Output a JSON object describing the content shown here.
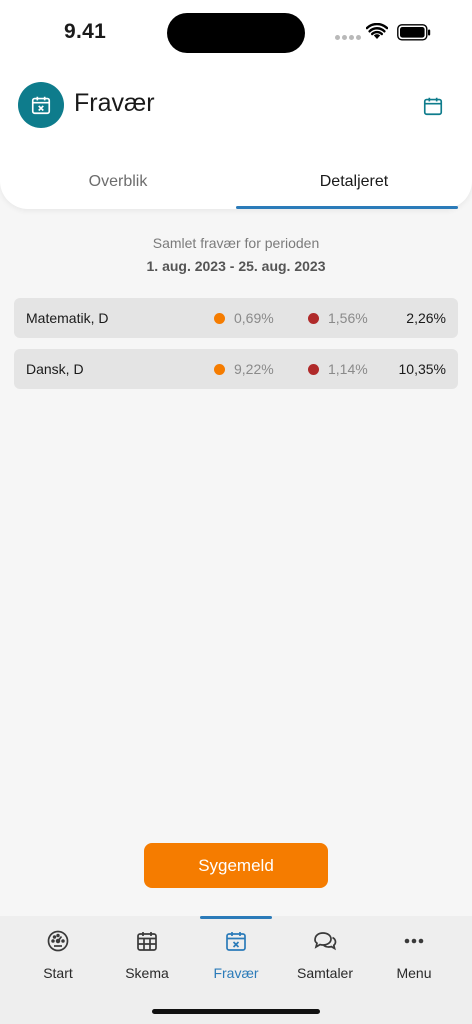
{
  "status_bar": {
    "time": "9.41"
  },
  "header": {
    "title": "Fravær"
  },
  "tabs": [
    {
      "label": "Overblik",
      "active": false
    },
    {
      "label": "Detaljeret",
      "active": true
    }
  ],
  "summary": {
    "label": "Samlet fravær for perioden",
    "period": "1. aug. 2023 - 25. aug. 2023"
  },
  "subjects": [
    {
      "name": "Matematik, D",
      "orange_value": "0,69%",
      "red_value": "1,56%",
      "total": "2,26%"
    },
    {
      "name": "Dansk, D",
      "orange_value": "9,22%",
      "red_value": "1,14%",
      "total": "10,35%"
    }
  ],
  "actions": {
    "sick_label": "Sygemeld"
  },
  "nav": [
    {
      "label": "Start",
      "icon": "gauge-icon",
      "active": false
    },
    {
      "label": "Skema",
      "icon": "calendar-grid-icon",
      "active": false
    },
    {
      "label": "Fravær",
      "icon": "calendar-x-icon",
      "active": true
    },
    {
      "label": "Samtaler",
      "icon": "chat-bubbles-icon",
      "active": false
    },
    {
      "label": "Menu",
      "icon": "more-dots-icon",
      "active": false
    }
  ],
  "colors": {
    "accent_teal": "#0e7c8c",
    "accent_blue": "#2b7bb9",
    "orange": "#f57c00",
    "red": "#b02a2a"
  }
}
